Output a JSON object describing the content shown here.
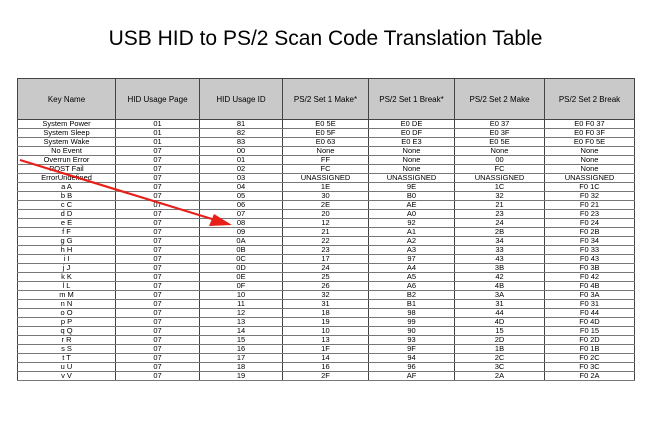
{
  "title": "USB HID to PS/2 Scan Code Translation Table",
  "headers": [
    "Key Name",
    "HID Usage Page",
    "HID Usage ID",
    "PS/2 Set 1 Make*",
    "PS/2 Set 1 Break*",
    "PS/2 Set 2 Make",
    "PS/2 Set 2 Break"
  ],
  "rows": [
    [
      "System Power",
      "01",
      "81",
      "E0 5E",
      "E0 DE",
      "E0 37",
      "E0 F0 37"
    ],
    [
      "System Sleep",
      "01",
      "82",
      "E0 5F",
      "E0 DF",
      "E0 3F",
      "E0 F0 3F"
    ],
    [
      "System Wake",
      "01",
      "83",
      "E0 63",
      "E0 E3",
      "E0 5E",
      "E0 F0 5E"
    ],
    [
      "No Event",
      "07",
      "00",
      "None",
      "None",
      "None",
      "None"
    ],
    [
      "Overrun Error",
      "07",
      "01",
      "FF",
      "None",
      "00",
      "None"
    ],
    [
      "POST Fail",
      "07",
      "02",
      "FC",
      "None",
      "FC",
      "None"
    ],
    [
      "ErrorUndefined",
      "07",
      "03",
      "UNASSIGNED",
      "UNASSIGNED",
      "UNASSIGNED",
      "UNASSIGNED"
    ],
    [
      "a A",
      "07",
      "04",
      "1E",
      "9E",
      "1C",
      "F0 1C"
    ],
    [
      "b B",
      "07",
      "05",
      "30",
      "B0",
      "32",
      "F0 32"
    ],
    [
      "c C",
      "07",
      "06",
      "2E",
      "AE",
      "21",
      "F0 21"
    ],
    [
      "d D",
      "07",
      "07",
      "20",
      "A0",
      "23",
      "F0 23"
    ],
    [
      "e E",
      "07",
      "08",
      "12",
      "92",
      "24",
      "F0 24"
    ],
    [
      "f F",
      "07",
      "09",
      "21",
      "A1",
      "2B",
      "F0 2B"
    ],
    [
      "g G",
      "07",
      "0A",
      "22",
      "A2",
      "34",
      "F0 34"
    ],
    [
      "h H",
      "07",
      "0B",
      "23",
      "A3",
      "33",
      "F0 33"
    ],
    [
      "i I",
      "07",
      "0C",
      "17",
      "97",
      "43",
      "F0 43"
    ],
    [
      "j J",
      "07",
      "0D",
      "24",
      "A4",
      "3B",
      "F0 3B"
    ],
    [
      "k K",
      "07",
      "0E",
      "25",
      "A5",
      "42",
      "F0 42"
    ],
    [
      "l L",
      "07",
      "0F",
      "26",
      "A6",
      "4B",
      "F0 4B"
    ],
    [
      "m M",
      "07",
      "10",
      "32",
      "B2",
      "3A",
      "F0 3A"
    ],
    [
      "n N",
      "07",
      "11",
      "31",
      "B1",
      "31",
      "F0 31"
    ],
    [
      "o O",
      "07",
      "12",
      "18",
      "98",
      "44",
      "F0 44"
    ],
    [
      "p P",
      "07",
      "13",
      "19",
      "99",
      "4D",
      "F0 4D"
    ],
    [
      "q Q",
      "07",
      "14",
      "10",
      "90",
      "15",
      "F0 15"
    ],
    [
      "r R",
      "07",
      "15",
      "13",
      "93",
      "2D",
      "F0 2D"
    ],
    [
      "s S",
      "07",
      "16",
      "1F",
      "9F",
      "1B",
      "F0 1B"
    ],
    [
      "t T",
      "07",
      "17",
      "14",
      "94",
      "2C",
      "F0 2C"
    ],
    [
      "u U",
      "07",
      "18",
      "16",
      "96",
      "3C",
      "F0 3C"
    ],
    [
      "v V",
      "07",
      "19",
      "2F",
      "AF",
      "2A",
      "F0 2A"
    ]
  ],
  "annotation": {
    "color": "#e8201a"
  }
}
